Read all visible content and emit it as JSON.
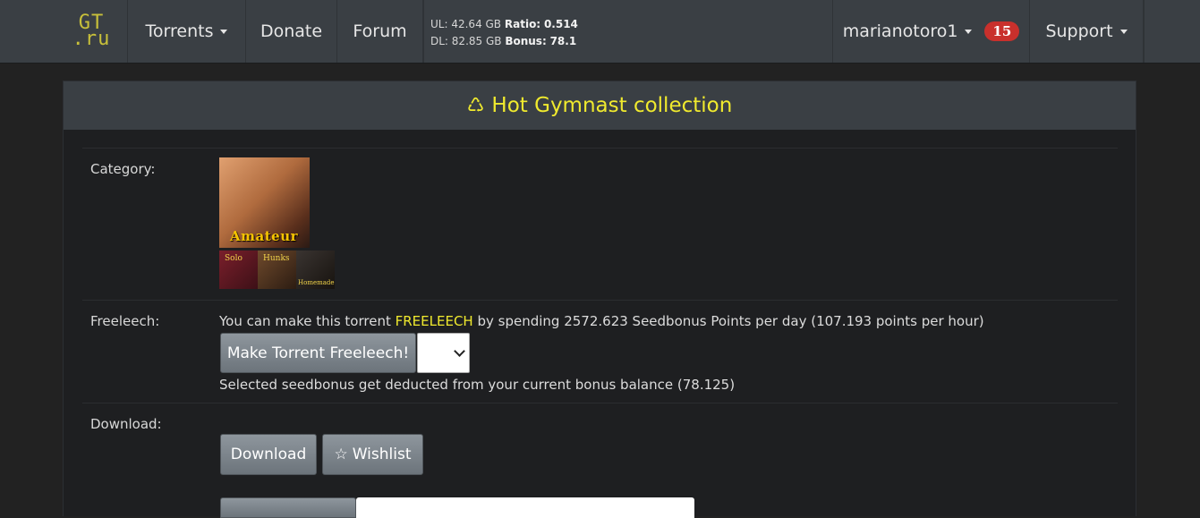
{
  "nav": {
    "logo_line1": "GT",
    "logo_line2": ".ru",
    "torrents": "Torrents",
    "donate": "Donate",
    "forum": "Forum",
    "stats": {
      "ul_label": "UL:",
      "ul_value": "42.64 GB",
      "ratio_label": "Ratio:",
      "ratio_value": "0.514",
      "dl_label": "DL:",
      "dl_value": "82.85 GB",
      "bonus_label": "Bonus:",
      "bonus_value": "78.1"
    },
    "username": "marianotoro1",
    "notification_count": "15",
    "support": "Support"
  },
  "torrent": {
    "title": "Hot Gymnast collection",
    "category_label": "Category:",
    "category_main": "Amateur",
    "category_tags": [
      "Solo",
      "Hunks",
      "Homemade"
    ],
    "freeleech_label": "Freeleech:",
    "freeleech_prefix": "You can make this torrent",
    "freeleech_word": "FREELEECH",
    "freeleech_suffix": "by spending 2572.623 Seedbonus Points per day (107.193 points per hour)",
    "freeleech_button": "Make Torrent Freeleech!",
    "freeleech_select_value": "",
    "freeleech_note": "Selected seedbonus get deducted from your current bonus balance (78.125)",
    "download_label": "Download:",
    "download_button": "Download",
    "wishlist_button": "Wishlist"
  },
  "colors": {
    "accent_yellow": "#f0ea2e",
    "badge_red": "#c9302c",
    "navbar": "#3a3f44",
    "background": "#222222"
  }
}
